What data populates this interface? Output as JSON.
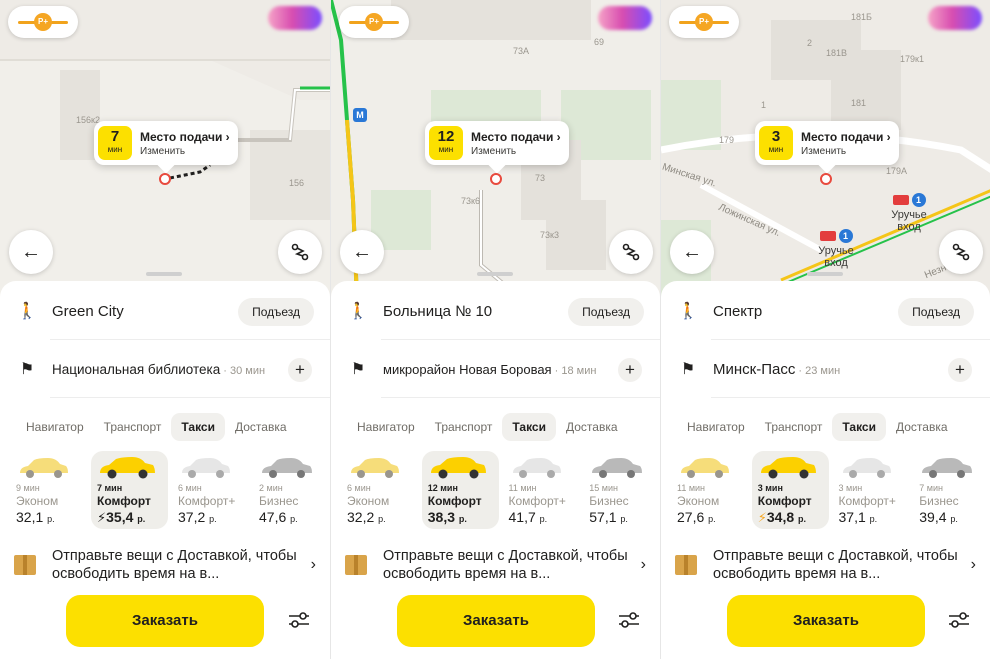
{
  "panels": [
    {
      "id": "p1",
      "pickup": {
        "minutes": "7",
        "min_label": "мин",
        "title": "Место подачи",
        "change": "Изменить"
      },
      "map_labels": [
        "156к2",
        "156"
      ],
      "from": {
        "name": "Green City",
        "entrance_label": "Подъезд"
      },
      "to": {
        "name": "Национальная библиотека",
        "duration": "30 мин"
      },
      "tabs": [
        "Навигатор",
        "Транспорт",
        "Такси",
        "Доставка"
      ],
      "active_tab": 2,
      "tariffs": [
        {
          "time": "9 мин",
          "name": "Эконом",
          "price": "32,1",
          "currency": "р.",
          "surge": false
        },
        {
          "time": "7 мин",
          "name": "Комфорт",
          "price": "35,4",
          "currency": "р.",
          "surge": true,
          "surge_color": "#21201f",
          "active": true
        },
        {
          "time": "6 мин",
          "name": "Комфорт+",
          "price": "37,2",
          "currency": "р.",
          "surge": false
        },
        {
          "time": "2 мин",
          "name": "Бизнес",
          "price": "47,6",
          "currency": "р.",
          "surge": false
        }
      ],
      "promo": "Отправьте вещи с Доставкой, чтобы освободить время на в...",
      "order_label": "Заказать"
    },
    {
      "id": "p2",
      "pickup": {
        "minutes": "12",
        "min_label": "мин",
        "title": "Место подачи",
        "change": "Изменить"
      },
      "map_labels": [
        "73А",
        "73",
        "73к6",
        "73к3",
        "69"
      ],
      "from": {
        "name": "Больница № 10",
        "entrance_label": "Подъезд"
      },
      "to": {
        "name": "микрорайон Новая Боровая",
        "duration": "18 мин"
      },
      "tabs": [
        "Навигатор",
        "Транспорт",
        "Такси",
        "Доставка"
      ],
      "active_tab": 2,
      "tariffs": [
        {
          "time": "6 мин",
          "name": "Эконом",
          "price": "32,2",
          "currency": "р.",
          "surge": false
        },
        {
          "time": "12 мин",
          "name": "Комфорт",
          "price": "38,3",
          "currency": "р.",
          "surge": false,
          "active": true
        },
        {
          "time": "11 мин",
          "name": "Комфорт+",
          "price": "41,7",
          "currency": "р.",
          "surge": false
        },
        {
          "time": "15 мин",
          "name": "Бизнес",
          "price": "57,1",
          "currency": "р.",
          "surge": false
        }
      ],
      "promo": "Отправьте вещи с Доставкой, чтобы освободить время на в...",
      "order_label": "Заказать"
    },
    {
      "id": "p3",
      "pickup": {
        "minutes": "3",
        "min_label": "мин",
        "title": "Место подачи",
        "change": "Изменить"
      },
      "map_labels": [
        "181Б",
        "181В",
        "179",
        "179А",
        "181",
        "179к1",
        "2",
        "1"
      ],
      "streets": [
        "Минская ул.",
        "Ложинская ул.",
        "Незнакомая"
      ],
      "metro_entrances": [
        {
          "label": "Уручье вход",
          "num": "1"
        },
        {
          "label": "Уручье вход",
          "num": "1"
        }
      ],
      "from": {
        "name": "Спектр",
        "entrance_label": "Подъезд"
      },
      "to": {
        "name": "Минск-Пасс",
        "duration": "23 мин"
      },
      "tabs": [
        "Навигатор",
        "Транспорт",
        "Такси",
        "Доставка"
      ],
      "active_tab": 2,
      "tariffs": [
        {
          "time": "11 мин",
          "name": "Эконом",
          "price": "27,6",
          "currency": "р.",
          "surge": false
        },
        {
          "time": "3 мин",
          "name": "Комфорт",
          "price": "34,8",
          "currency": "р.",
          "surge": true,
          "surge_color": "#f5a623",
          "active": true
        },
        {
          "time": "3 мин",
          "name": "Комфорт+",
          "price": "37,1",
          "currency": "р.",
          "surge": false
        },
        {
          "time": "7 мин",
          "name": "Бизнес",
          "price": "39,4",
          "currency": "р.",
          "surge": false
        }
      ],
      "promo": "Отправьте вещи с Доставкой, чтобы освободить время на в...",
      "order_label": "Заказать"
    }
  ],
  "icons": {
    "back": "arrow-left-icon",
    "route": "route-icon",
    "from": "person-icon",
    "to": "finish-flag-icon",
    "plus": "plus-icon",
    "promo": "box-icon",
    "chevron": "chevron-right-icon",
    "settings": "sliders-icon",
    "toll": "toll-road-icon"
  },
  "colors": {
    "accent": "#fce000",
    "pin": "#e84a3e",
    "route_green": "#26c24a",
    "route_yellow": "#f5c518"
  }
}
